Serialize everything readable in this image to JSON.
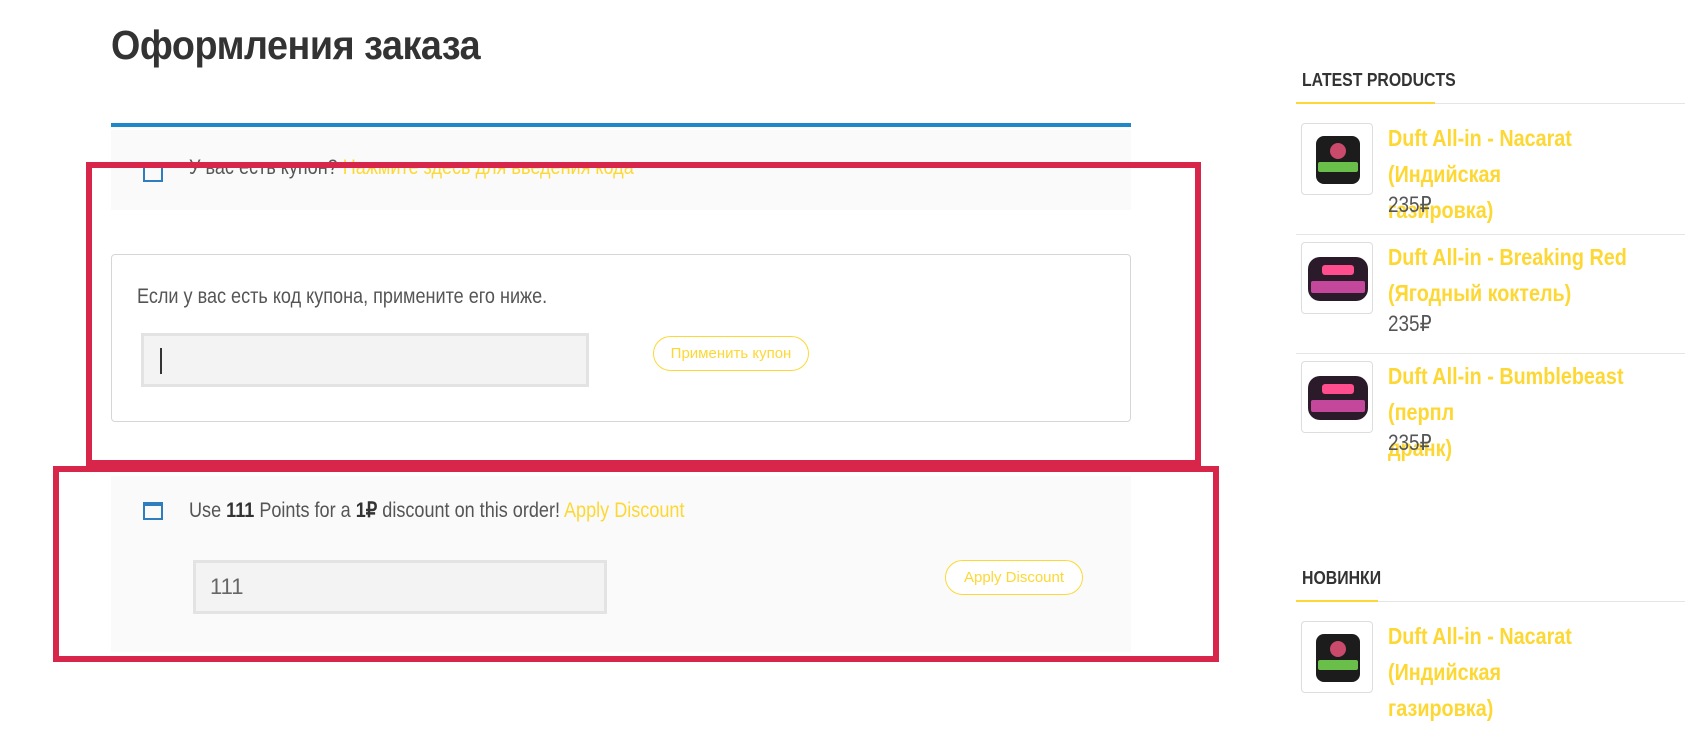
{
  "page": {
    "title": "Оформления заказа"
  },
  "coupon_notice": {
    "text": "У вас есть купон?",
    "link": "Нажмите здесь для введения кода"
  },
  "coupon_form": {
    "description": "Если у вас есть код купона, примените его ниже.",
    "input_value": "",
    "button": "Применить купон"
  },
  "points_notice": {
    "text_use": "Use",
    "points": "111",
    "text_points_for": "Points for a",
    "discount": "1₽",
    "text_discount_on": "discount on this order!",
    "link": "Apply Discount",
    "input_value": "111",
    "button": "Apply Discount"
  },
  "sidebar": {
    "latest": {
      "title": "LATEST PRODUCTS",
      "products": [
        {
          "name_line1": "Duft All-in - Nacarat (Индийская",
          "name_line2": "газировка)",
          "price": "235₽"
        },
        {
          "name_line1": "Duft All-in - Breaking Red",
          "name_line2": "(Ягодный коктель)",
          "price": "235₽"
        },
        {
          "name_line1": "Duft All-in - Bumblebeast (перпл",
          "name_line2": "дранк)",
          "price": "235₽"
        }
      ]
    },
    "new": {
      "title": "НОВИНКИ",
      "products": [
        {
          "name_line1": "Duft All-in - Nacarat (Индийская",
          "name_line2": "газировка)"
        }
      ]
    }
  },
  "colors": {
    "accent": "#fdd835",
    "rule": "#1e88c8",
    "highlight": "#d7264a"
  }
}
